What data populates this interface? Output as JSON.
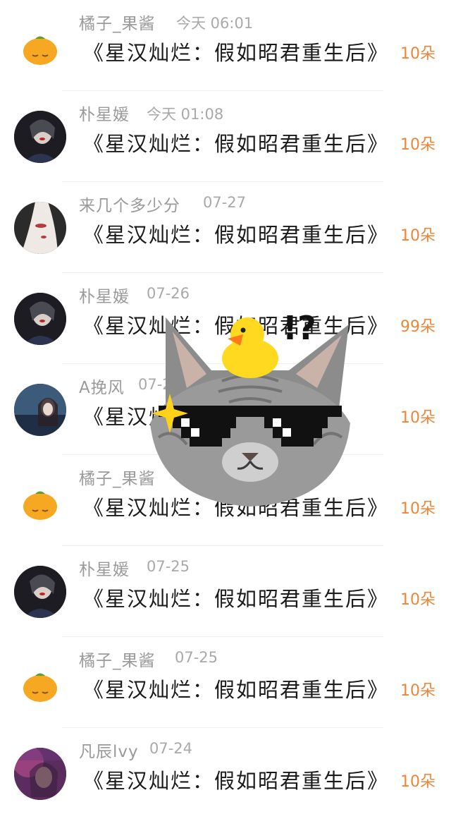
{
  "comments": [
    {
      "name": "橘子_果酱",
      "time": "今天 06:01",
      "text": "《星汉灿烂：假如昭君重生后》",
      "gift": "10朵",
      "avatar": "orange"
    },
    {
      "name": "朴星媛",
      "time": "今天 01:08",
      "text": "《星汉灿烂：假如昭君重生后》",
      "gift": "10朵",
      "avatar": "photo"
    },
    {
      "name": "来几个多少分",
      "time": "07-27",
      "text": "《星汉灿烂：假如昭君重生后》",
      "gift": "10朵",
      "avatar": "photo"
    },
    {
      "name": "朴星媛",
      "time": "07-26",
      "text": "《星汉灿烂：假如昭君重生后》",
      "gift": "99朵",
      "avatar": "photo"
    },
    {
      "name": "A挽风",
      "time": "07-2",
      "text": "《星汉灿烂",
      "gift": "10朵",
      "avatar": "photo"
    },
    {
      "name": "橘子_果酱",
      "time": "",
      "text": "《星汉灿烂：假如昭君重生后》",
      "gift": "10朵",
      "avatar": "orange"
    },
    {
      "name": "朴星媛",
      "time": "07-25",
      "text": "《星汉灿烂：假如昭君重生后》",
      "gift": "10朵",
      "avatar": "photo"
    },
    {
      "name": "橘子_果酱",
      "time": "07-25",
      "text": "《星汉灿烂：假如昭君重生后》",
      "gift": "10朵",
      "avatar": "orange"
    },
    {
      "name": "凡辰lvy",
      "time": "07-24",
      "text": "《星汉灿烂：假如昭君重生后》",
      "gift": "10朵",
      "avatar": "photo"
    }
  ],
  "sticker": {
    "exclaim": "!?"
  },
  "colors": {
    "gift": "#e8873a",
    "name": "#9a9a9a",
    "text": "#1a1a1a"
  }
}
